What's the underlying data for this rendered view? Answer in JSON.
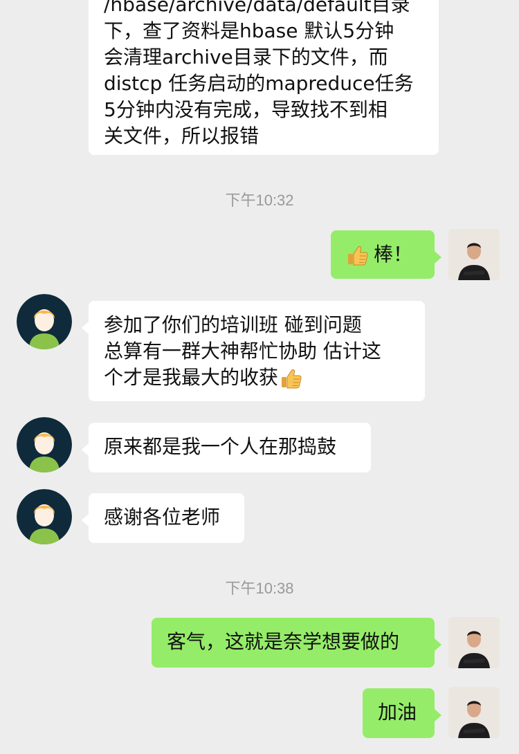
{
  "messages": {
    "m1": {
      "lines": [
        "/hbase/archive/data/default目录",
        "下，查了资料是hbase 默认5分钟",
        "会清理archive目录下的文件，而",
        "distcp 任务启动的mapreduce任务",
        "5分钟内没有完成，导致找不到相",
        "关文件，所以报错"
      ]
    },
    "ts1": "下午10:32",
    "m2": {
      "text": "棒！"
    },
    "m3": {
      "lines": [
        "参加了你们的培训班   碰到问题",
        "总算有一群大神帮忙协助  估计这",
        "个才是我最大的收获"
      ]
    },
    "m4": {
      "text": "原来都是我一个人在那捣鼓"
    },
    "m5": {
      "text": "感谢各位老师"
    },
    "ts2": "下午10:38",
    "m6": {
      "text": "客气，这就是奈学想要做的"
    },
    "m7": {
      "text": "加油"
    }
  },
  "icons": {
    "thumbs_up": "thumbs-up-emoji",
    "user_avatar": "default-user-avatar",
    "agent_avatar": "agent-photo-avatar"
  },
  "colors": {
    "background": "#ededed",
    "incoming_bubble": "#ffffff",
    "outgoing_bubble": "#95ec69",
    "timestamp": "#999999",
    "avatar_bg": "#0f2a3b",
    "avatar_hair": "#f7b84b",
    "avatar_shirt": "#8bc34a"
  }
}
